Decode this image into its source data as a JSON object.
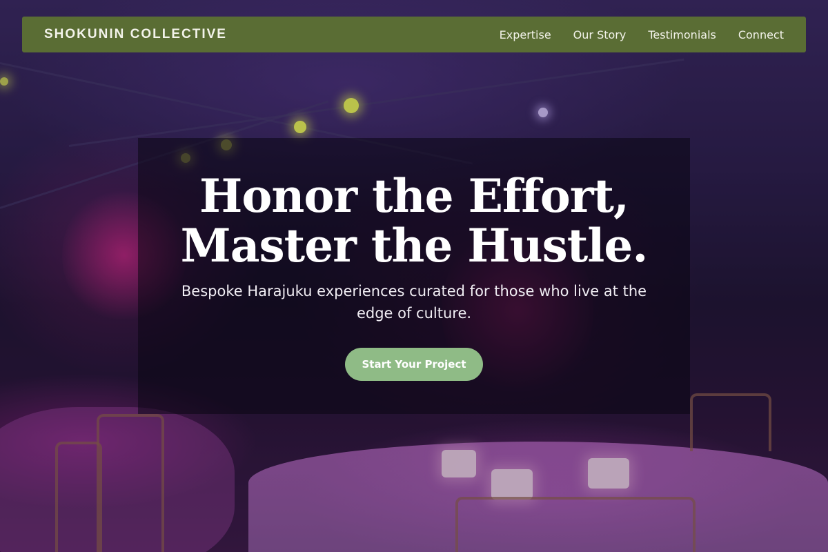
{
  "nav": {
    "brand": "SHOKUNIN COLLECTIVE",
    "links": [
      "Expertise",
      "Our Story",
      "Testimonials",
      "Connect"
    ]
  },
  "hero": {
    "title_line1": "Honor the Effort,",
    "title_line2": "Master the Hustle.",
    "subtitle": "Bespoke Harajuku experiences curated for those who live at the edge of culture.",
    "cta_label": "Start Your Project"
  },
  "colors": {
    "nav_bg": "#5a6d34",
    "cta_bg": "#8fbb86",
    "text": "#ffffff"
  }
}
